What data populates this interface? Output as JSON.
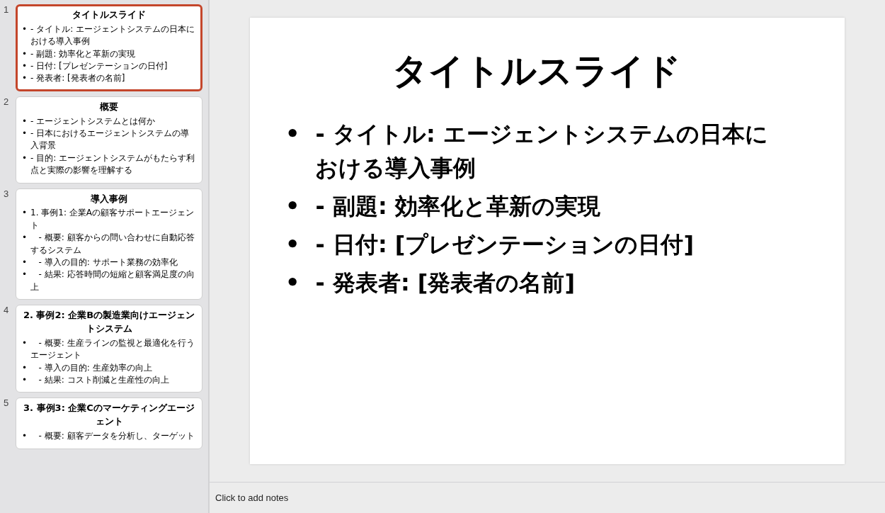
{
  "slides": [
    {
      "number": "1",
      "selected": true,
      "title": "タイトルスライド",
      "bullets": [
        {
          "marker": "•",
          "text": "- タイトル: エージェントシステムの日本における導入事例"
        },
        {
          "marker": "•",
          "text": "- 副題: 効率化と革新の実現"
        },
        {
          "marker": "•",
          "text": "- 日付: [プレゼンテーションの日付]"
        },
        {
          "marker": "•",
          "text": "- 発表者: [発表者の名前]"
        }
      ]
    },
    {
      "number": "2",
      "selected": false,
      "title": "概要",
      "bullets": [
        {
          "marker": "•",
          "text": "- エージェントシステムとは何か"
        },
        {
          "marker": "•",
          "text": "- 日本におけるエージェントシステムの導入背景"
        },
        {
          "marker": "•",
          "text": "- 目的: エージェントシステムがもたらす利点と実際の影響を理解する"
        }
      ]
    },
    {
      "number": "3",
      "selected": false,
      "title": "導入事例",
      "bullets": [
        {
          "marker": "•",
          "text": "1. 事例1: 企業Aの顧客サポートエージェント"
        },
        {
          "marker": "•",
          "text": "   - 概要: 顧客からの問い合わせに自動応答するシステム"
        },
        {
          "marker": "•",
          "text": "   - 導入の目的: サポート業務の効率化"
        },
        {
          "marker": "•",
          "text": "   - 結果: 応答時間の短縮と顧客満足度の向上"
        }
      ]
    },
    {
      "number": "4",
      "selected": false,
      "title": "2. 事例2: 企業Bの製造業向けエージェントシステム",
      "bullets": [
        {
          "marker": "•",
          "text": "   - 概要: 生産ラインの監視と最適化を行うエージェント"
        },
        {
          "marker": "•",
          "text": "   - 導入の目的: 生産効率の向上"
        },
        {
          "marker": "•",
          "text": "   - 結果: コスト削減と生産性の向上"
        }
      ]
    },
    {
      "number": "5",
      "selected": false,
      "title": "3. 事例3: 企業Cのマーケティングエージェント",
      "bullets": [
        {
          "marker": "•",
          "text": "   - 概要: 顧客データを分析し、ターゲット"
        }
      ]
    }
  ],
  "current_slide": {
    "title": "タイトルスライド",
    "bullets": [
      {
        "marker": "•",
        "text": "- タイトル: エージェントシステムの日本における導入事例"
      },
      {
        "marker": "•",
        "text": "- 副題: 効率化と革新の実現"
      },
      {
        "marker": "•",
        "text": "- 日付: [プレゼンテーションの日付]"
      },
      {
        "marker": "•",
        "text": "- 発表者: [発表者の名前]"
      }
    ]
  },
  "notes": {
    "placeholder": "Click to add notes"
  }
}
